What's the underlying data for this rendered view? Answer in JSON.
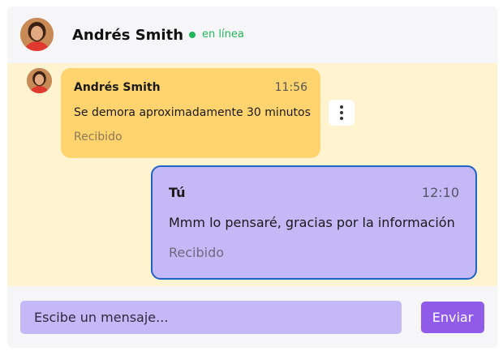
{
  "header": {
    "contact_name": "Andrés Smith",
    "status": "en línea",
    "status_color": "#1fb65a"
  },
  "messages": [
    {
      "sender": "Andrés Smith",
      "time": "11:56",
      "text": "Se demora aproximadamente 30 minutos",
      "receipt": "Recibido",
      "bubble_color": "#ffd36e"
    },
    {
      "sender": "Tú",
      "time": "12:10",
      "text": "Mmm lo pensaré, gracias por la información",
      "receipt": "Recibido",
      "bubble_color": "#c5b8f6"
    }
  ],
  "icons": {
    "more_options": "more-vertical-icon",
    "avatar": "user-avatar"
  },
  "composer": {
    "placeholder": "Escibe un mensaje...",
    "value": "",
    "send_label": "Enviar",
    "send_color": "#8f5be8"
  },
  "colors": {
    "chat_background": "#fff4cf",
    "sent_border": "#1d63c8"
  }
}
